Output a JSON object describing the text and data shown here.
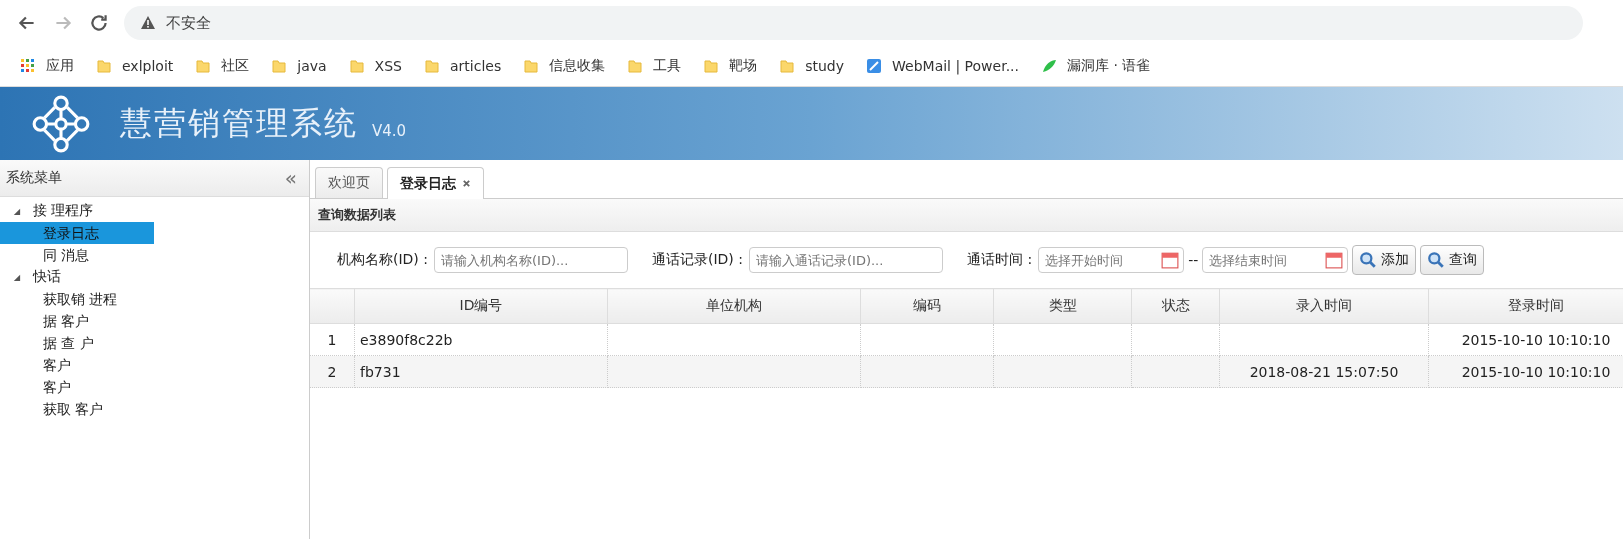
{
  "browser": {
    "security": "不安全",
    "bookmarks": [
      {
        "label": "应用",
        "kind": "apps"
      },
      {
        "label": "exlploit",
        "kind": "folder"
      },
      {
        "label": "社区",
        "kind": "folder"
      },
      {
        "label": "java",
        "kind": "folder"
      },
      {
        "label": "XSS",
        "kind": "folder"
      },
      {
        "label": "articles",
        "kind": "folder"
      },
      {
        "label": "信息收集",
        "kind": "folder"
      },
      {
        "label": "工具",
        "kind": "folder"
      },
      {
        "label": "靶场",
        "kind": "folder"
      },
      {
        "label": "study",
        "kind": "folder"
      },
      {
        "label": "WebMail | Power...",
        "kind": "mail"
      },
      {
        "label": "漏洞库 · 语雀",
        "kind": "leaf"
      }
    ]
  },
  "header": {
    "title": "慧营销管理系统",
    "version": "V4.0"
  },
  "sidebar": {
    "title": "系统菜单",
    "collapse": "«",
    "items": [
      {
        "label": "接 理程序",
        "expanded": true,
        "selected": false,
        "children": [
          {
            "label": "登录日志",
            "selected": true
          },
          {
            "label": "同 消息",
            "selected": false
          }
        ]
      },
      {
        "label": "快话",
        "expanded": true,
        "selected": false,
        "children": [
          {
            "label": "获取销 进程",
            "selected": false
          },
          {
            "label": "据 客户",
            "selected": false
          },
          {
            "label": "据 查 户",
            "selected": false
          },
          {
            "label": "客户",
            "selected": false
          },
          {
            "label": "客户",
            "selected": false
          },
          {
            "label": "获取 客户",
            "selected": false
          }
        ]
      }
    ]
  },
  "tabs": [
    {
      "label": "欢迎页",
      "selected": false,
      "closable": false
    },
    {
      "label": "登录日志",
      "selected": true,
      "closable": true
    }
  ],
  "panel_title": "查询数据列表",
  "filters": [
    {
      "label": "机构名称(ID) :",
      "placeholder": "请输入机构名称(ID)...",
      "kind": "text"
    },
    {
      "label": "通话记录(ID) :",
      "placeholder": "请输入通话记录(ID)...",
      "kind": "text"
    },
    {
      "label": "通话时间 :",
      "placeholder": "选择开始时间",
      "kind": "date",
      "separator": "--",
      "placeholder_end": "选择结束时间"
    }
  ],
  "buttons": [
    "添加",
    "查询"
  ],
  "table": {
    "columns": [
      "",
      "ID编号",
      "单位机构",
      "编码",
      "类型",
      "状态",
      "录入时间",
      "登录时间"
    ],
    "rows": [
      [
        "1",
        "e3890f8c22b",
        "",
        "",
        "",
        "",
        "",
        "2015-10-10 10:10:10"
      ],
      [
        "2",
        "fb731",
        "",
        "",
        "",
        "",
        "2018-08-21 15:07:50",
        "2015-10-10 10:10:10"
      ]
    ]
  }
}
